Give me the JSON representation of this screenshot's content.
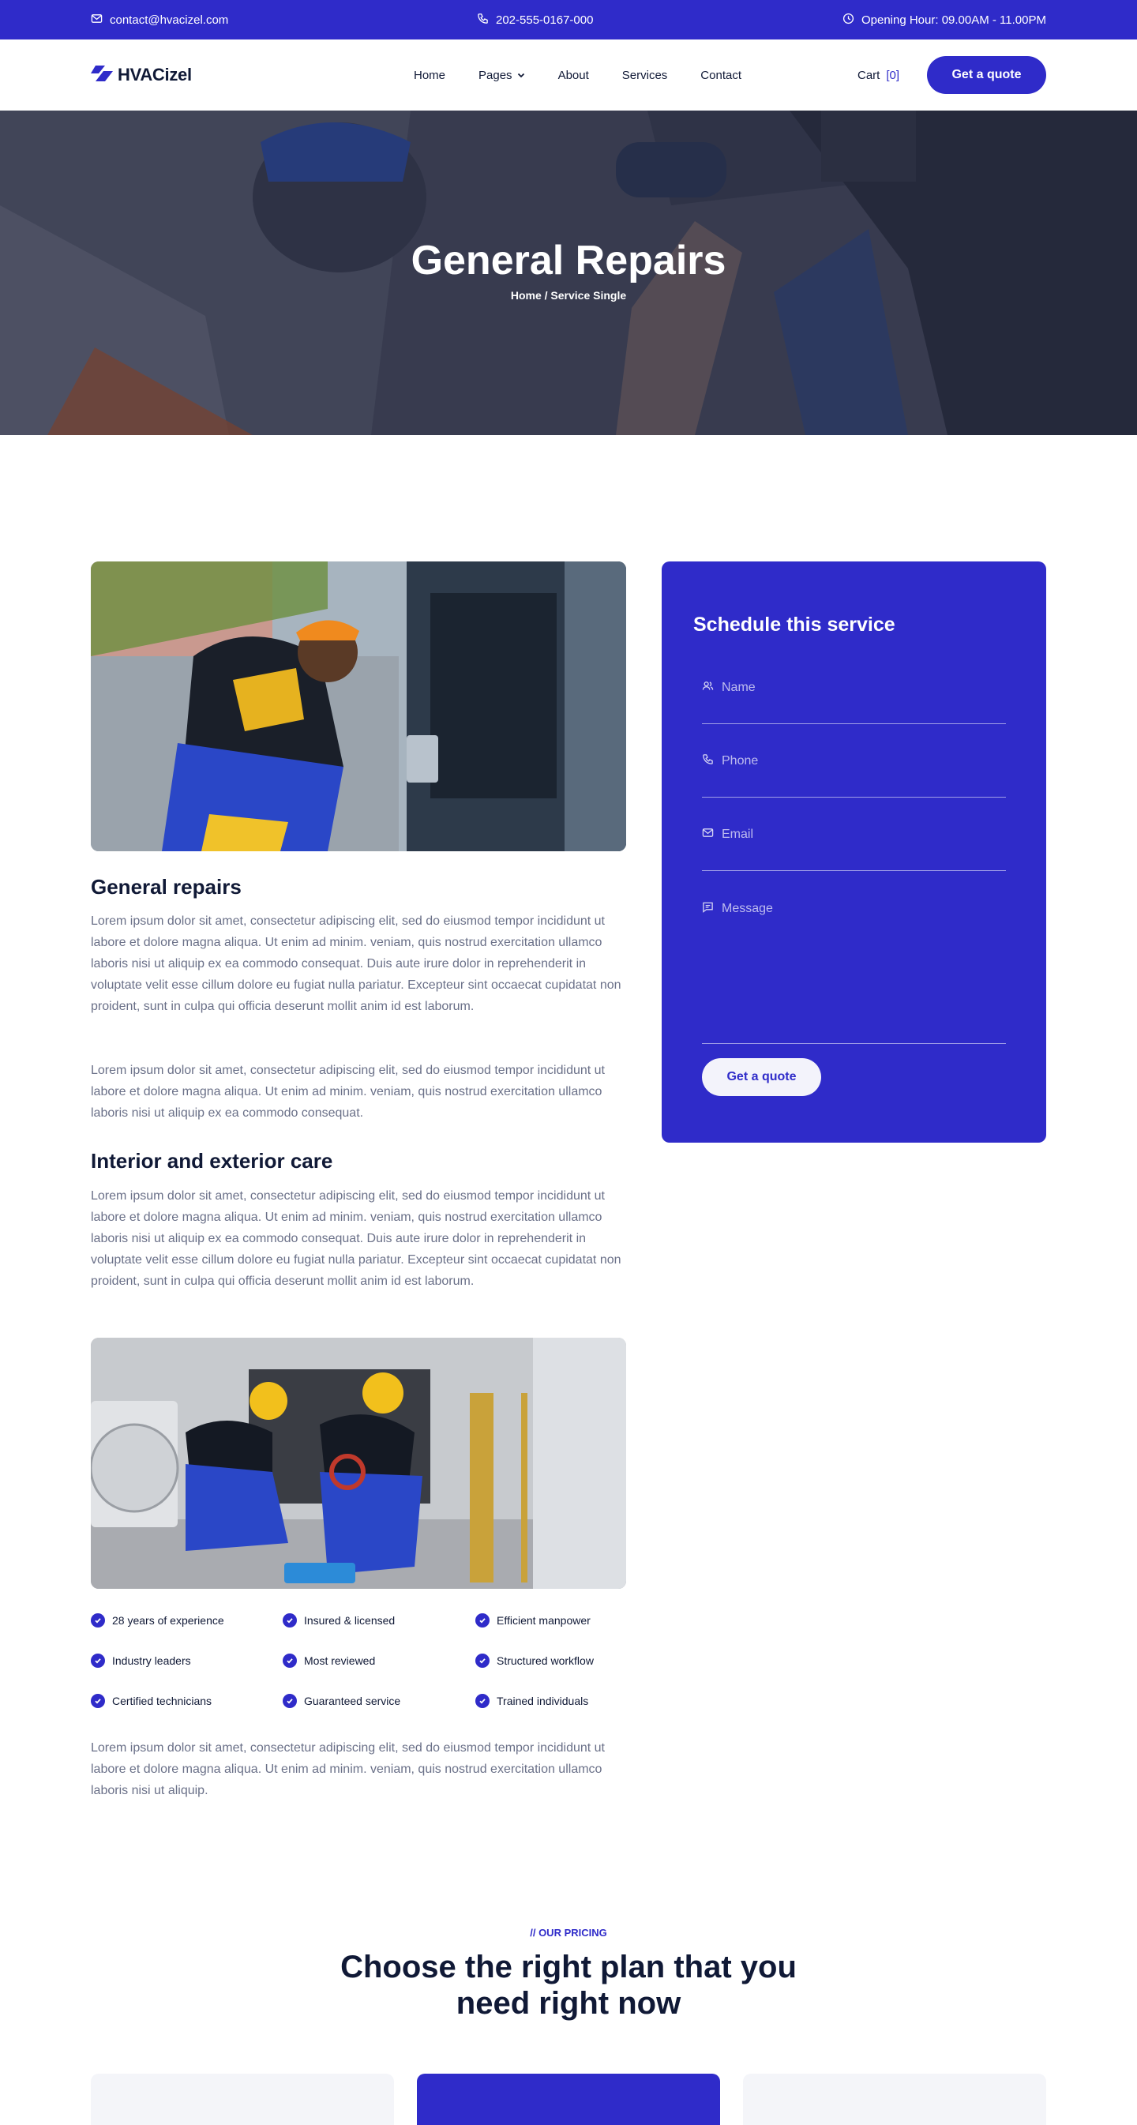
{
  "topbar": {
    "email": "contact@hvacizel.com",
    "phone": "202-555-0167-000",
    "hours": "Opening Hour: 09.00AM - 11.00PM"
  },
  "header": {
    "logo": "HVACizel",
    "nav": [
      "Home",
      "Pages",
      "About",
      "Services",
      "Contact"
    ],
    "cart_label": "Cart",
    "cart_count": "[0]",
    "quote_button": "Get a quote"
  },
  "hero": {
    "title": "General Repairs",
    "breadcrumb": "Home / Service Single"
  },
  "content": {
    "section1_title": "General repairs",
    "section1_p1": "Lorem ipsum dolor sit amet, consectetur adipiscing elit, sed do eiusmod tempor incididunt ut labore et dolore magna aliqua. Ut enim ad minim. veniam, quis nostrud exercitation ullamco laboris nisi ut aliquip ex ea commodo consequat. Duis aute irure dolor in reprehenderit in voluptate velit esse cillum dolore eu fugiat nulla pariatur. Excepteur sint occaecat cupidatat non proident, sunt in culpa qui officia deserunt mollit anim id est laborum.",
    "section1_p2": "Lorem ipsum dolor sit amet, consectetur adipiscing elit, sed do eiusmod tempor incididunt ut labore et dolore magna aliqua. Ut enim ad minim. veniam, quis nostrud exercitation ullamco laboris nisi ut aliquip ex ea commodo consequat.",
    "section2_title": "Interior and exterior care",
    "section2_p1": "Lorem ipsum dolor sit amet, consectetur adipiscing elit, sed do eiusmod tempor incididunt ut labore et dolore magna aliqua. Ut enim ad minim. veniam, quis nostrud exercitation ullamco laboris nisi ut aliquip ex ea commodo consequat. Duis aute irure dolor in reprehenderit in voluptate velit esse cillum dolore eu fugiat nulla pariatur. Excepteur sint occaecat cupidatat non proident, sunt in culpa qui officia deserunt mollit anim id est laborum.",
    "checklist": [
      "28 years of experience",
      "Insured & licensed",
      "Efficient manpower",
      "Industry leaders",
      "Most reviewed",
      "Structured workflow",
      "Certified technicians",
      "Guaranteed service",
      "Trained individuals"
    ],
    "closing_p": "Lorem ipsum dolor sit amet, consectetur adipiscing elit, sed do eiusmod tempor incididunt ut labore et dolore magna aliqua. Ut enim ad minim. veniam, quis nostrud exercitation ullamco laboris nisi ut aliquip."
  },
  "form": {
    "title": "Schedule this service",
    "name_placeholder": "Name",
    "phone_placeholder": "Phone",
    "email_placeholder": "Email",
    "message_placeholder": "Message",
    "submit": "Get a quote"
  },
  "pricing": {
    "tag": "// OUR PRICING",
    "title": "Choose the right plan that you need right now"
  },
  "colors": {
    "brand": "#2f2bc9",
    "dark_text": "#101936",
    "body_text": "#6a7088"
  },
  "icons": [
    "mail-icon",
    "phone-icon",
    "clock-icon",
    "chevron-down-icon",
    "user-icon",
    "message-icon",
    "check-icon"
  ]
}
